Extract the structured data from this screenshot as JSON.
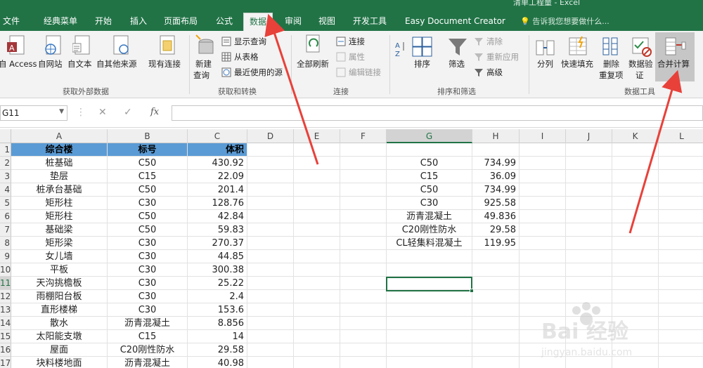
{
  "app": {
    "title": "清单工程量 - Excel"
  },
  "tabs": [
    {
      "label": "文件"
    },
    {
      "label": "经典菜单"
    },
    {
      "label": "开始"
    },
    {
      "label": "插入"
    },
    {
      "label": "页面布局"
    },
    {
      "label": "公式"
    },
    {
      "label": "数据"
    },
    {
      "label": "审阅"
    },
    {
      "label": "视图"
    },
    {
      "label": "开发工具"
    },
    {
      "label": "Easy Document Creator"
    }
  ],
  "tell_me": "告诉我您想要做什么...",
  "ribbon": {
    "access": "自 Access",
    "web": "自网站",
    "text": "自文本",
    "other": "自其他来源",
    "existing": "现有连接",
    "new_query_1": "新建",
    "new_query_2": "查询",
    "show_queries": "显示查询",
    "from_table": "从表格",
    "recent_sources": "最近使用的源",
    "refresh_all": "全部刷新",
    "connections": "连接",
    "properties": "属性",
    "edit_links": "编辑链接",
    "sort": "排序",
    "filter": "筛选",
    "clear": "清除",
    "reapply": "重新应用",
    "advanced": "高级",
    "text_to_columns": "分列",
    "flash_fill": "快速填充",
    "remove_dup_1": "删除",
    "remove_dup_2": "重复项",
    "validation_1": "数据验",
    "validation_2": "证",
    "consolidate": "合并计算",
    "group_get_external": "获取外部数据",
    "group_get_transform": "获取和转换",
    "group_connections": "连接",
    "group_sort_filter": "排序和筛选",
    "group_data_tools": "数据工具"
  },
  "formula_bar": {
    "name_box": "G11",
    "fx": "fx",
    "value": ""
  },
  "columns": [
    "A",
    "B",
    "C",
    "D",
    "E",
    "F",
    "G",
    "H",
    "I",
    "J",
    "K",
    "L"
  ],
  "rows": [
    {
      "n": "1",
      "a": "综合楼",
      "b": "标号",
      "c": "体积",
      "g": "",
      "h": ""
    },
    {
      "n": "2",
      "a": "桩基础",
      "b": "C50",
      "c": "430.92",
      "g": "C50",
      "h": "734.99"
    },
    {
      "n": "3",
      "a": "垫层",
      "b": "C15",
      "c": "22.09",
      "g": "C15",
      "h": "36.09"
    },
    {
      "n": "4",
      "a": "桩承台基础",
      "b": "C50",
      "c": "201.4",
      "g": "C50",
      "h": "734.99"
    },
    {
      "n": "5",
      "a": "矩形柱",
      "b": "C30",
      "c": "128.76",
      "g": "C30",
      "h": "925.58"
    },
    {
      "n": "6",
      "a": "矩形柱",
      "b": "C50",
      "c": "42.84",
      "g": "沥青混凝土",
      "h": "49.836"
    },
    {
      "n": "7",
      "a": "基础梁",
      "b": "C50",
      "c": "59.83",
      "g": "C20刚性防水",
      "h": "29.58"
    },
    {
      "n": "8",
      "a": "矩形梁",
      "b": "C30",
      "c": "270.37",
      "g": "CL轻集料混凝土",
      "h": "119.95"
    },
    {
      "n": "9",
      "a": "女儿墙",
      "b": "C30",
      "c": "44.85",
      "g": "",
      "h": ""
    },
    {
      "n": "10",
      "a": "平板",
      "b": "C30",
      "c": "300.38",
      "g": "",
      "h": ""
    },
    {
      "n": "11",
      "a": "天沟挑檐板",
      "b": "C30",
      "c": "25.22",
      "g": "",
      "h": ""
    },
    {
      "n": "12",
      "a": "雨棚阳台板",
      "b": "C30",
      "c": "2.4",
      "g": "",
      "h": ""
    },
    {
      "n": "13",
      "a": "直形楼梯",
      "b": "C30",
      "c": "153.6",
      "g": "",
      "h": ""
    },
    {
      "n": "14",
      "a": "散水",
      "b": "沥青混凝土",
      "c": "8.856",
      "g": "",
      "h": ""
    },
    {
      "n": "15",
      "a": "太阳能支墩",
      "b": "C15",
      "c": "14",
      "g": "",
      "h": ""
    },
    {
      "n": "16",
      "a": "屋面",
      "b": "C20刚性防水",
      "c": "29.58",
      "g": "",
      "h": ""
    },
    {
      "n": "17",
      "a": "块料楼地面",
      "b": "沥青混凝土",
      "c": "40.98",
      "g": "",
      "h": ""
    }
  ],
  "watermark": {
    "brand": "Bai 经验",
    "url": "jingyan.baidu.com"
  },
  "colors": {
    "excel_green": "#217346",
    "header_fill": "#5b9bd5",
    "annotation": "#e8413a"
  }
}
